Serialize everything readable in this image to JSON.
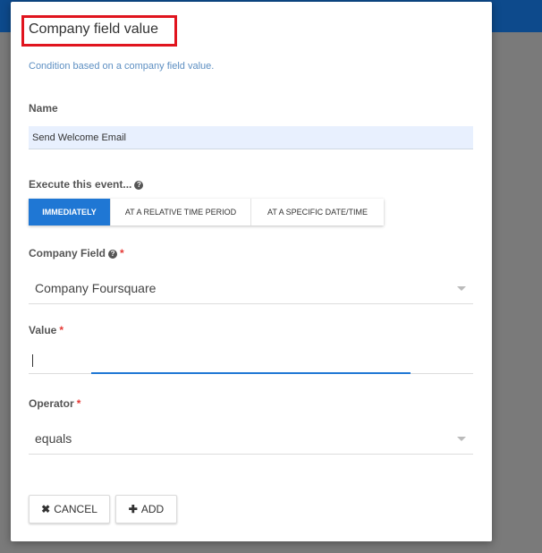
{
  "dialog": {
    "title": "Company field value",
    "subtitle": "Condition based on a company field value."
  },
  "name": {
    "label": "Name",
    "value": "Send Welcome Email"
  },
  "execute": {
    "label": "Execute this event...",
    "options": [
      "IMMEDIATELY",
      "AT A RELATIVE TIME PERIOD",
      "AT A SPECIFIC DATE/TIME"
    ],
    "selected": "IMMEDIATELY"
  },
  "company_field": {
    "label": "Company Field",
    "required_mark": "*",
    "selected": "Company Foursquare"
  },
  "value": {
    "label": "Value",
    "required_mark": "*",
    "current": ""
  },
  "operator": {
    "label": "Operator",
    "required_mark": "*",
    "selected": "equals"
  },
  "actions": {
    "cancel_label": "CANCEL",
    "add_label": "ADD"
  },
  "icons": {
    "help": "question-circle-icon",
    "cancel": "times-icon",
    "add": "plus-icon",
    "dropdown": "caret-down-icon"
  },
  "colors": {
    "accent": "#1f77d4",
    "required": "#e53935",
    "highlight_box": "#e0141e"
  }
}
